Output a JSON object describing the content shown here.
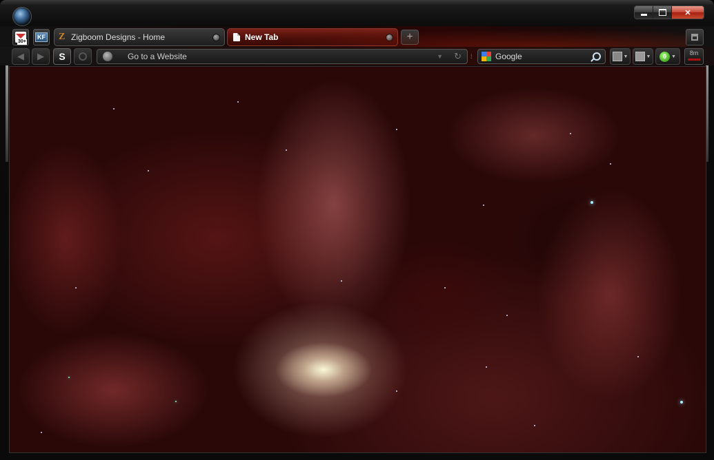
{
  "window": {
    "title_controls": {
      "minimize": "",
      "maximize": "",
      "close": "✕"
    }
  },
  "extensions": {
    "gmail_count": "30+",
    "kf_label": "KF"
  },
  "tabs": [
    {
      "title": "Zigboom Designs - Home",
      "active": false
    },
    {
      "title": "New Tab",
      "active": true
    }
  ],
  "newtab": {
    "label": "+"
  },
  "navbar": {
    "back": "◀",
    "forward": "▶",
    "s_label": "S",
    "address_placeholder": "Go to a Website",
    "dropdown": "▼",
    "reload": "↻",
    "search_engine": "Google",
    "counter_badge": "0",
    "timer_label": "8m"
  }
}
